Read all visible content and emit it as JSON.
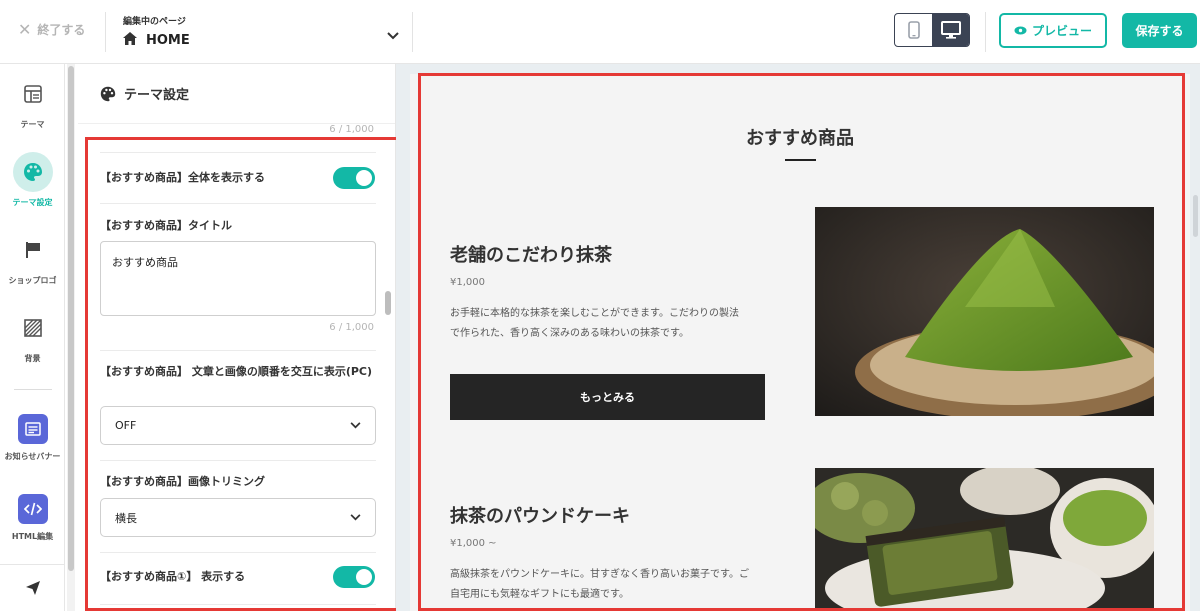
{
  "topbar": {
    "exit_label": "終了する",
    "editing_caption": "編集中のページ",
    "page_name": "HOME",
    "preview_label": "プレビュー",
    "save_label": "保存する"
  },
  "rail": {
    "items": [
      {
        "label": "テーマ",
        "icon": "layout-icon"
      },
      {
        "label": "テーマ設定",
        "icon": "palette-icon"
      },
      {
        "label": "ショップロゴ",
        "icon": "flag-icon"
      },
      {
        "label": "背景",
        "icon": "hatched-square-icon"
      },
      {
        "label": "お知らせバナー",
        "icon": "banner-icon"
      },
      {
        "label": "HTML編集",
        "icon": "code-icon"
      }
    ],
    "bottom_icon": "send-icon"
  },
  "panel": {
    "title": "テーマ設定",
    "top_counter": "6 / 1,000",
    "show_all_label": "【おすすめ商品】全体を表示する",
    "title_label": "【おすすめ商品】タイトル",
    "title_value": "おすすめ商品",
    "title_counter": "6 / 1,000",
    "alternate_label": "【おすすめ商品】 文章と画像の順番を交互に表示(PC)",
    "alternate_value": "OFF",
    "trimming_label": "【おすすめ商品】画像トリミング",
    "trimming_value": "横長",
    "item1_label": "【おすすめ商品①】 表示する"
  },
  "preview": {
    "section_title": "おすすめ商品",
    "products": [
      {
        "name": "老舗のこだわり抹茶",
        "price": "¥1,000",
        "desc_line1": "お手軽に本格的な抹茶を楽しむことができます。こだわりの製法",
        "desc_line2": "で作られた、香り高く深みのある味わいの抹茶です。",
        "button": "もっとみる"
      },
      {
        "name": "抹茶のパウンドケーキ",
        "price": "¥1,000 ~",
        "desc_line1": "高級抹茶をパウンドケーキに。甘すぎなく香り高いお菓子です。ご",
        "desc_line2": "自宅用にも気軽なギフトにも最適です。"
      }
    ]
  },
  "colors": {
    "accent": "#13b8a6",
    "highlight_border": "#e53935",
    "dark": "#3b4354"
  }
}
